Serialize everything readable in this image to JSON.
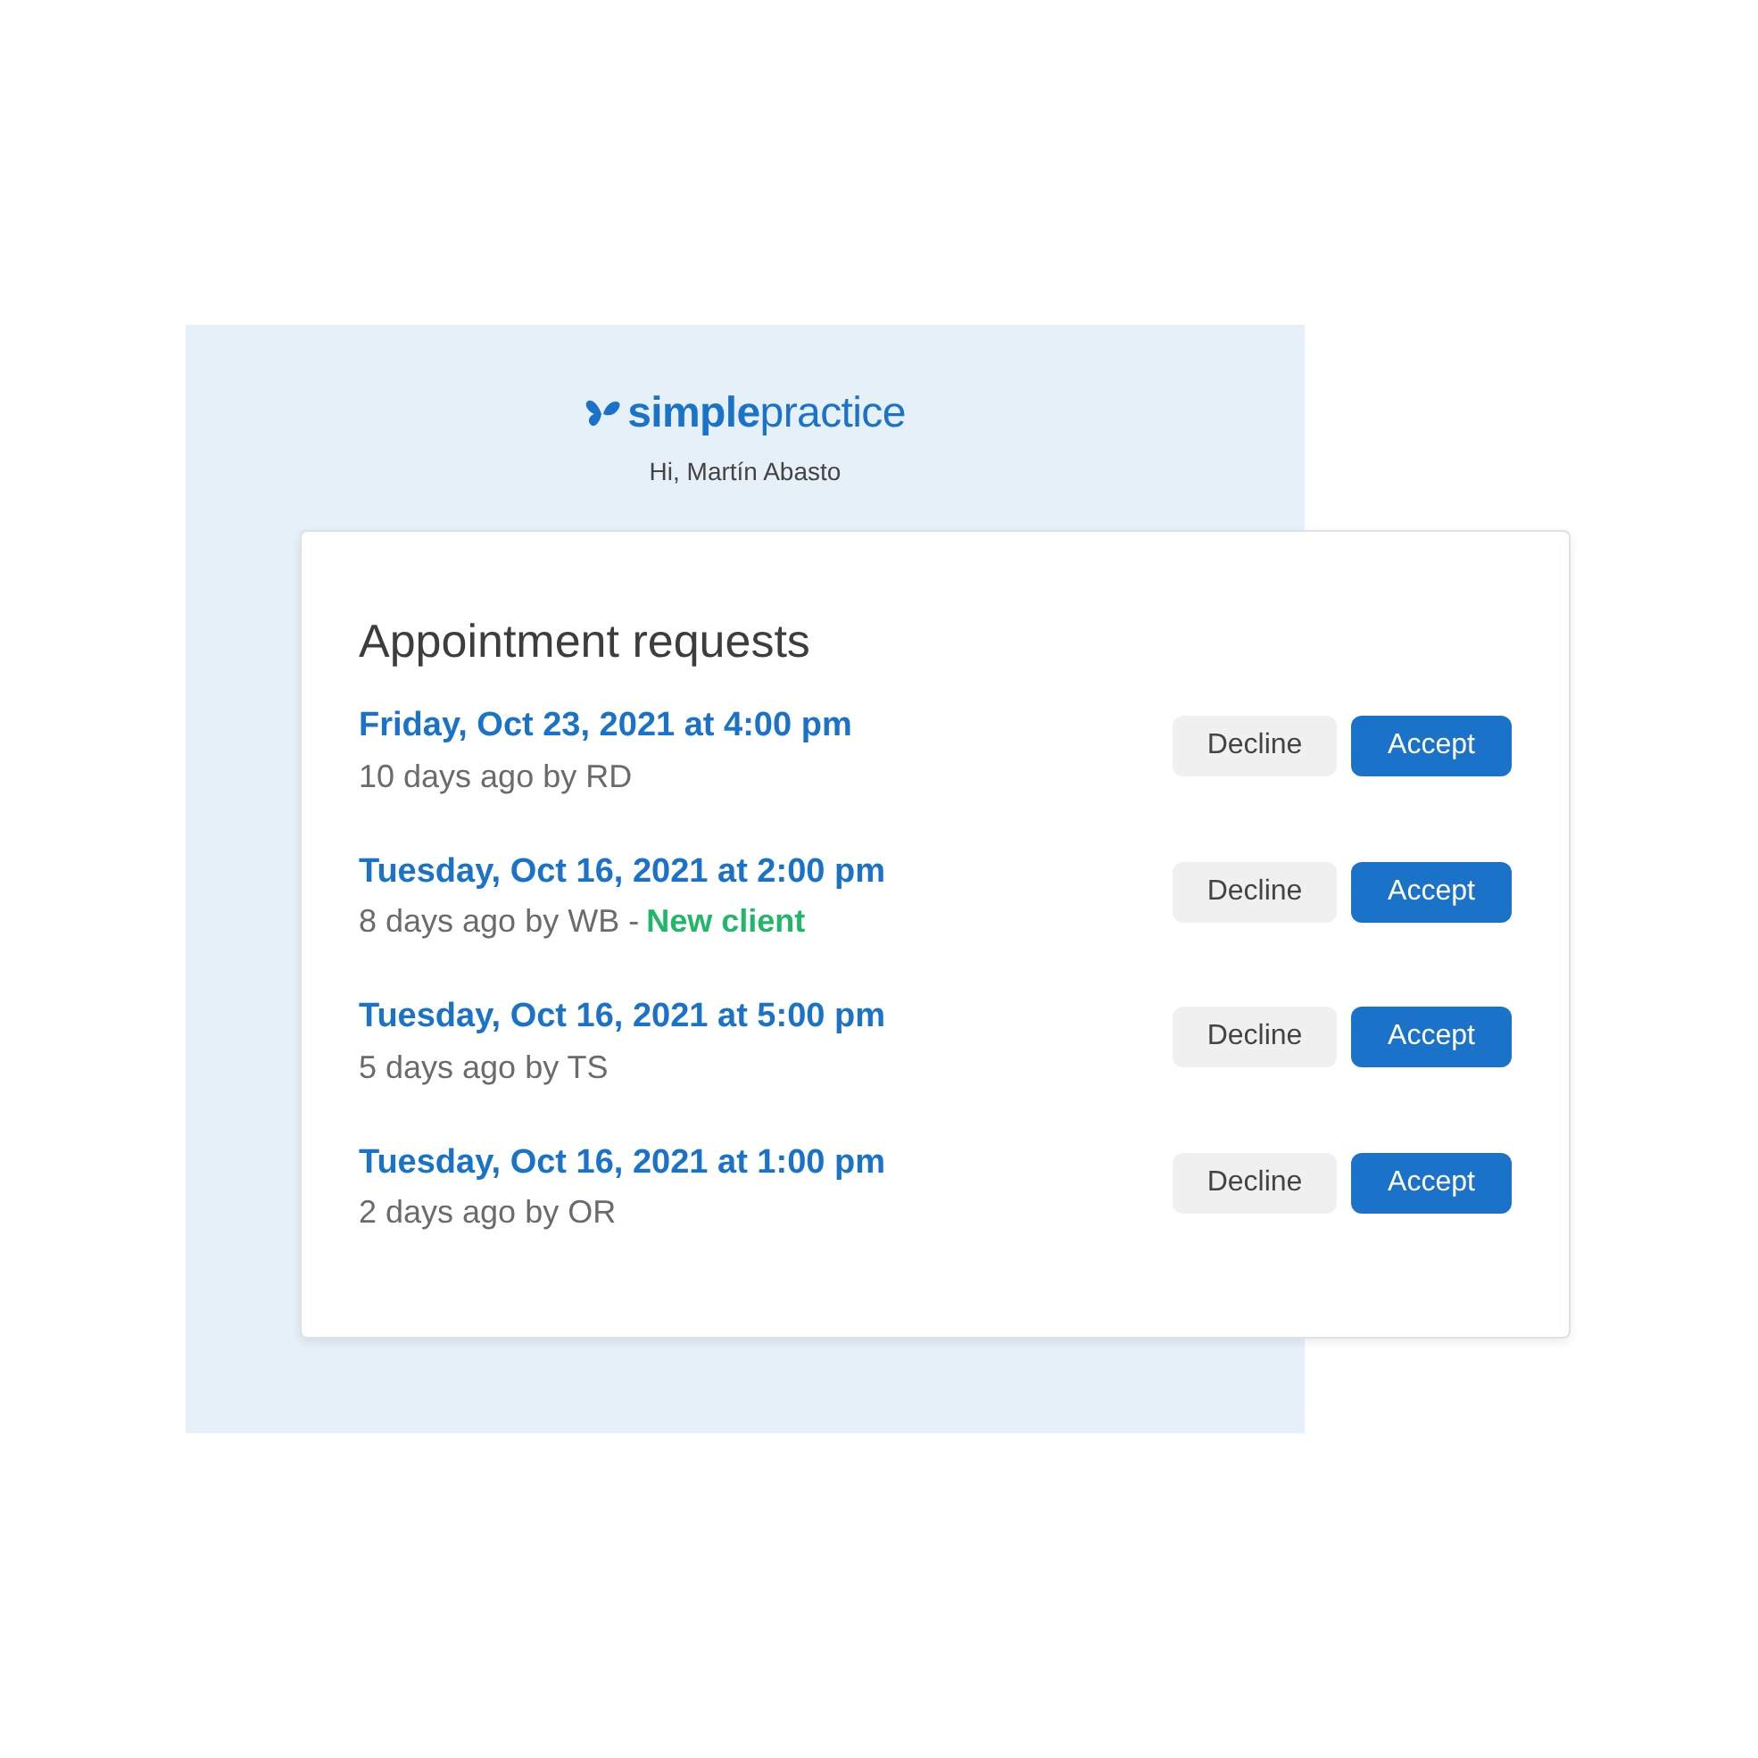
{
  "brand": {
    "logo": "**simple**practice",
    "greeting": "Hi, Martín Abasto"
  },
  "card": {
    "title": "Appointment requests",
    "requests": [
      {
        "when": "Friday, Oct 23, 2021 at 4:00 pm",
        "meta": "10 days ago by RD",
        "buttons": [
          "Decline",
          "Accept"
        ]
      },
      {
        "when": "Tuesday, Oct 16, 2021 at 2:00 pm",
        "meta": "8 days ago by WB -",
        "tag": "New client",
        "buttons": [
          "Decline",
          "Accept"
        ]
      },
      {
        "when": "Tuesday, Oct 16, 2021 at 5:00 pm",
        "meta": "5 days ago by TS",
        "buttons": [
          "Decline",
          "Accept"
        ]
      },
      {
        "when": "Tuesday, Oct 16, 2021 at 1:00 pm",
        "meta": "2 days ago by OR",
        "buttons": [
          "Decline",
          "Accept"
        ]
      }
    ]
  }
}
